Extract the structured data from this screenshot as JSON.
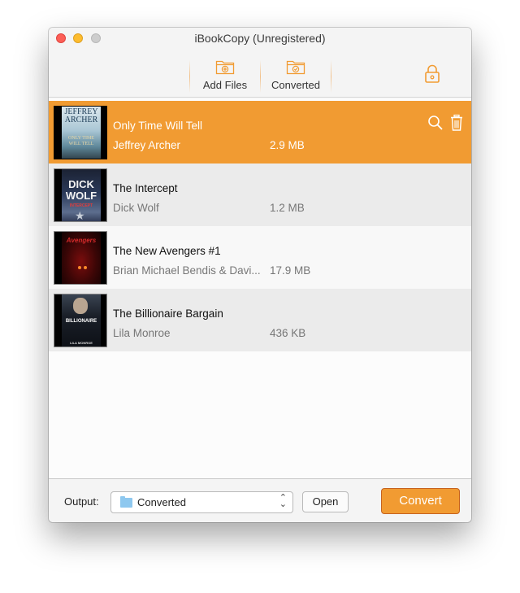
{
  "window": {
    "title": "iBookCopy (Unregistered)"
  },
  "toolbar": {
    "add_files_label": "Add Files",
    "converted_label": "Converted",
    "accent_color": "#f19b32"
  },
  "books": [
    {
      "title": "Only Time Will Tell",
      "author": "Jeffrey Archer",
      "size": "2.9 MB",
      "selected": true,
      "cover": {
        "line1": "JEFFREY",
        "line2": "ARCHER",
        "line3": "ONLY TIME",
        "line4": "WILL TELL"
      }
    },
    {
      "title": "The Intercept",
      "author": "Dick Wolf",
      "size": "1.2 MB",
      "selected": false,
      "cover": {
        "line1": "DICK",
        "line2": "WOLF",
        "line3": "INTERCEPT"
      }
    },
    {
      "title": "The New Avengers #1",
      "author": "Brian Michael Bendis & Davi...",
      "size": "17.9 MB",
      "selected": false,
      "cover": {
        "line1": "Avengers"
      }
    },
    {
      "title": "The Billionaire Bargain",
      "author": "Lila Monroe",
      "size": "436 KB",
      "selected": false,
      "cover": {
        "line1": "BILLIONAIRE",
        "line2": "LILA MONROE"
      }
    }
  ],
  "row_actions": {
    "search_icon": "search-icon",
    "delete_icon": "trash-icon"
  },
  "footer": {
    "output_label": "Output:",
    "output_folder": "Converted",
    "open_label": "Open",
    "convert_label": "Convert"
  }
}
